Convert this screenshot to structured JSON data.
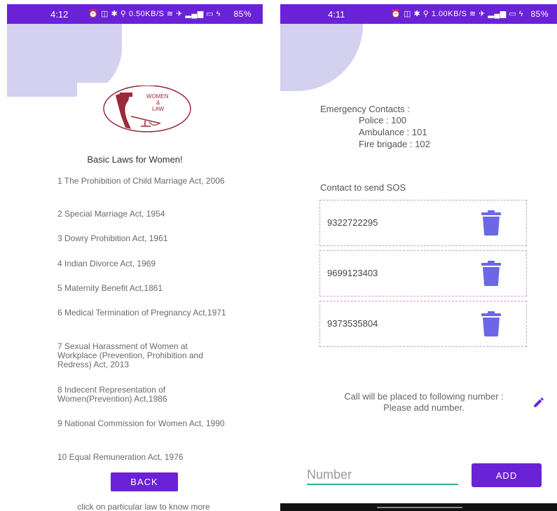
{
  "left_screen": {
    "status": {
      "time": "4:12",
      "icons": "⏰ ◫ ✱ ⚲ 0.50KB/S ≋ ✈ ▂▄▆ ▭ ϟ",
      "battery": "85%"
    },
    "logo": {
      "line1": "WOMEN",
      "line2": "&",
      "line3": "LAW"
    },
    "title": "Basic Laws for Women!",
    "laws": [
      "1 The Prohibition of Child Marriage Act, 2006",
      "2 Special Marriage Act, 1954",
      "3 Dowry Prohibition Act, 1961",
      "4 Indian Divorce Act, 1969",
      "5 Maternity Benefit Act,1861",
      "6 Medical Termination of Pregnancy Act,1971",
      "7 Sexual Harassment of Women at Workplace (Prevention, Prohibition and Redress) Act, 2013",
      "8 Indecent Representation of Women(Prevention) Act,1986",
      "9 National Commission for Women Act, 1990",
      "10 Equal Remuneration Act, 1976"
    ],
    "back_label": "BACK",
    "footer": "click on particular law to know more"
  },
  "right_screen": {
    "status": {
      "time": "4:11",
      "icons": "⏰ ◫ ✱ ⚲ 1.00KB/S ≋ ✈ ▂▄▆ ▭ ϟ",
      "battery": "85%"
    },
    "emergency": {
      "heading": "Emergency Contacts :",
      "police": "Police : 100",
      "ambulance": "Ambulance : 101",
      "fire": "Fire brigade : 102"
    },
    "sos_label": "Contact to send SOS",
    "contacts": [
      "9322722295",
      "9699123403",
      "9373535804"
    ],
    "call_line1": "Call will be placed to following number :",
    "call_line2": "Please add number.",
    "input_placeholder": "Number",
    "add_label": "ADD"
  },
  "colors": {
    "accent": "#6a22d6",
    "blob": "#d3d1ef",
    "trash": "#6b67e6",
    "input_underline": "#2ab0a2"
  }
}
